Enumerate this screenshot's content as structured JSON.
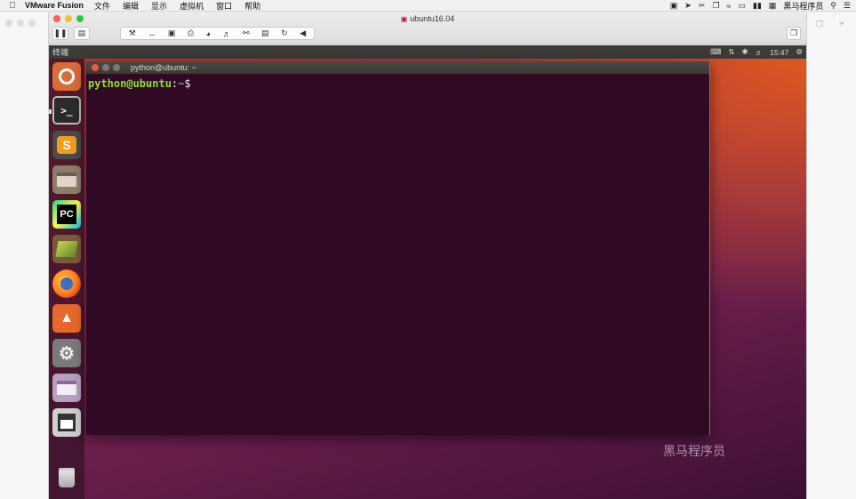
{
  "menubar": {
    "app_name": "VMware Fusion",
    "items": [
      "文件",
      "编辑",
      "显示",
      "虚拟机",
      "窗口",
      "帮助"
    ],
    "user_name": "黑马程序员"
  },
  "vm_window": {
    "title": "ubuntu16.04"
  },
  "ubuntu": {
    "panel_title": "终端",
    "clock": "15:47",
    "launcher_apps": [
      {
        "label": "PC"
      },
      {
        "label": "S"
      }
    ]
  },
  "terminal": {
    "title": "python@ubuntu: ~",
    "prompt_user": "python@ubuntu",
    "prompt_colon": ":",
    "prompt_path": "~",
    "prompt_symbol": "$"
  },
  "watermark": "黑马程序员",
  "colors": {
    "terminal_bg": "#300a24",
    "prompt_user": "#8ae234",
    "prompt_path": "#729fcf",
    "panel": "#3c3b37"
  }
}
